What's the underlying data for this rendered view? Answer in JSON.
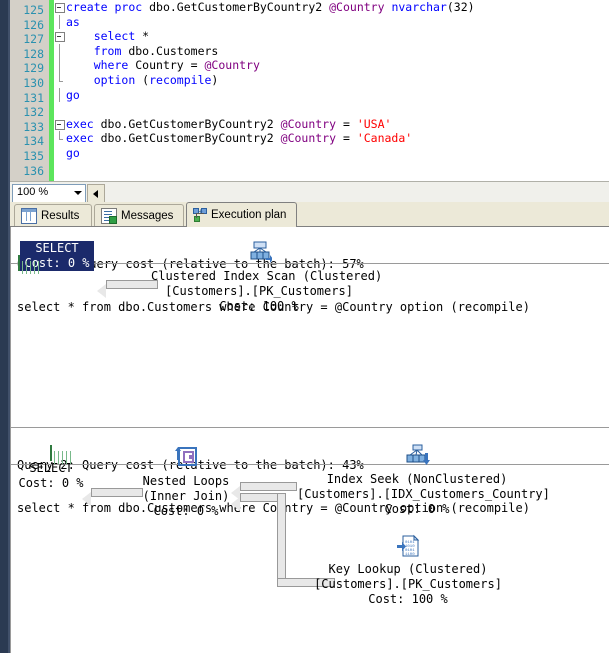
{
  "editor": {
    "lines": [
      {
        "num": "125",
        "marker": "box",
        "text": "create proc dbo.GetCustomerByCountry2 @Country nvarchar(32)"
      },
      {
        "num": "126",
        "marker": "line",
        "text": "as"
      },
      {
        "num": "127",
        "marker": "box2",
        "text": "    select *"
      },
      {
        "num": "128",
        "marker": "line2",
        "text": "    from dbo.Customers"
      },
      {
        "num": "129",
        "marker": "line2",
        "text": "    where Country = @Country"
      },
      {
        "num": "130",
        "marker": "line2end",
        "text": "    option (recompile)"
      },
      {
        "num": "131",
        "marker": "line",
        "text": "go"
      },
      {
        "num": "132",
        "marker": "none",
        "text": ""
      },
      {
        "num": "133",
        "marker": "box",
        "text": "exec dbo.GetCustomerByCountry2 @Country = 'USA'"
      },
      {
        "num": "134",
        "marker": "lineend",
        "text": "exec dbo.GetCustomerByCountry2 @Country = 'Canada'"
      },
      {
        "num": "135",
        "marker": "none",
        "text": "go"
      },
      {
        "num": "136",
        "marker": "none",
        "text": ""
      }
    ]
  },
  "zoom_bar": {
    "value": "100 %",
    "dropdown_icon": "chevron-down-icon",
    "split_icon": "left-arrow-icon"
  },
  "tabs": [
    {
      "label": "Results",
      "icon": "grid-icon",
      "active": false
    },
    {
      "label": "Messages",
      "icon": "document-icon",
      "active": false
    },
    {
      "label": "Execution plan",
      "icon": "plan-nodes-icon",
      "active": true
    }
  ],
  "plans": [
    {
      "header_line1": "Query 1: Query cost (relative to the batch): 57%",
      "header_line2": "select * from dbo.Customers where Country = @Country option (recompile)",
      "cost_percent": "57%",
      "nodes": [
        {
          "id": "select1",
          "icon": "select-result-icon",
          "selected": true,
          "lines": [
            "SELECT",
            "Cost: 0 %"
          ]
        },
        {
          "id": "cis1",
          "icon": "clustered-index-scan-icon",
          "selected": false,
          "lines": [
            "Clustered Index Scan (Clustered)",
            "[Customers].[PK_Customers]",
            "Cost: 100 %"
          ]
        }
      ]
    },
    {
      "header_line1": "Query 2: Query cost (relative to the batch): 43%",
      "header_line2": "select * from dbo.Customers where Country = @Country option (recompile)",
      "cost_percent": "43%",
      "nodes": [
        {
          "id": "select2",
          "icon": "select-result-icon",
          "selected": false,
          "lines": [
            "SELECT",
            "Cost: 0 %"
          ]
        },
        {
          "id": "loops2",
          "icon": "nested-loops-icon",
          "selected": false,
          "lines": [
            "Nested Loops",
            "(Inner Join)",
            "Cost: 0 %"
          ]
        },
        {
          "id": "seek2",
          "icon": "index-seek-icon",
          "selected": false,
          "lines": [
            "Index Seek (NonClustered)",
            "[Customers].[IDX_Customers_Country]",
            "Cost: 0 %"
          ]
        },
        {
          "id": "keylookup2",
          "icon": "key-lookup-icon",
          "selected": false,
          "lines": [
            "Key Lookup (Clustered)",
            "[Customers].[PK_Customers]",
            "Cost: 100 %"
          ]
        }
      ]
    }
  ],
  "colors": {
    "selection_navy": "#1b2a6b",
    "change_bar_green": "#5ce55c",
    "line_number_teal": "#2b91af",
    "keyword_blue": "#0000ff",
    "string_red": "#ff0000",
    "variable_purple": "#800080"
  }
}
